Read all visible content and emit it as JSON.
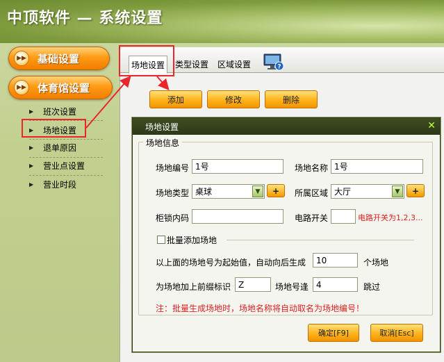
{
  "app": {
    "title": "中顶软件 — 系统设置"
  },
  "sidebar": {
    "menu": [
      {
        "label": "基础设置",
        "icon": "double-arrow-right-icon"
      },
      {
        "label": "体育馆设置",
        "icon": "double-arrow-right-icon"
      }
    ],
    "submenu": [
      {
        "label": "班次设置"
      },
      {
        "label": "场地设置"
      },
      {
        "label": "退单原因"
      },
      {
        "label": "营业点设置"
      },
      {
        "label": "营业时段"
      }
    ],
    "selected": "场地设置"
  },
  "tabs": [
    {
      "label": "场地设置",
      "active": true
    },
    {
      "label": "类型设置",
      "active": false
    },
    {
      "label": "区域设置",
      "active": false
    }
  ],
  "toolbar": {
    "add": "添加",
    "edit": "修改",
    "delete": "删除"
  },
  "dialog": {
    "title": "场地设置",
    "group_title": "场地信息",
    "fields": {
      "venue_no": {
        "label": "场地编号",
        "value": "1号"
      },
      "venue_name": {
        "label": "场地名称",
        "value": "1号"
      },
      "venue_type": {
        "label": "场地类型",
        "value": "桌球"
      },
      "area": {
        "label": "所属区域",
        "value": "大厅"
      },
      "locker_code": {
        "label": "柜锁内码",
        "value": ""
      },
      "circuit_switch": {
        "label": "电路开关",
        "value": "",
        "hint": "电路开关为1,2,3..."
      }
    },
    "batch": {
      "checkbox_label": "批量添加场地",
      "checked": false,
      "start_text": "以上面的场地号为起始值，自动向后生成",
      "count": "10",
      "count_unit": "个场地",
      "prefix_label": "为场地加上前缀标识",
      "prefix": "Z",
      "skip_label": "场地号逢",
      "skip": "4",
      "skip_suffix": "跳过",
      "note": "注：批量生成场地时，场地名称将自动取名为场地编号！"
    },
    "ok": "确定[F9]",
    "cancel": "取消[Esc]",
    "close_icon": "close-icon"
  },
  "colors": {
    "accent_orange": "#ff9b14",
    "highlight_red": "#e8262c",
    "dialog_header": "#2c3818"
  }
}
